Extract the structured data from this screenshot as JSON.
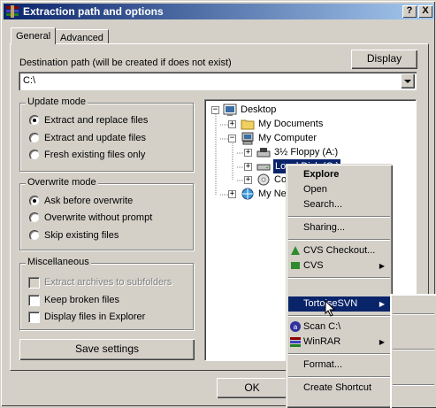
{
  "window": {
    "title": "Extraction path and options",
    "help_button": "?",
    "close_button": "X"
  },
  "tabs": [
    {
      "label": "General"
    },
    {
      "label": "Advanced"
    }
  ],
  "destination": {
    "label": "Destination path (will be created if does not exist)",
    "value": "C:\\",
    "display_button": "Display"
  },
  "update_mode": {
    "title": "Update mode",
    "options": [
      {
        "label": "Extract and replace files",
        "selected": true
      },
      {
        "label": "Extract and update files",
        "selected": false
      },
      {
        "label": "Fresh existing files only",
        "selected": false
      }
    ]
  },
  "overwrite_mode": {
    "title": "Overwrite mode",
    "options": [
      {
        "label": "Ask before overwrite",
        "selected": true
      },
      {
        "label": "Overwrite without prompt",
        "selected": false
      },
      {
        "label": "Skip existing files",
        "selected": false
      }
    ]
  },
  "misc": {
    "title": "Miscellaneous",
    "options": [
      {
        "label": "Extract archives to subfolders",
        "checked": false,
        "disabled": true
      },
      {
        "label": "Keep broken files",
        "checked": false,
        "disabled": false
      },
      {
        "label": "Display files in Explorer",
        "checked": false,
        "disabled": false
      }
    ]
  },
  "save_button": "Save settings",
  "ok_button": "OK",
  "tree": {
    "nodes": [
      {
        "label": "Desktop",
        "icon": "desktop-icon",
        "expander": "−"
      },
      {
        "label": "My Documents",
        "icon": "folder-icon",
        "expander": "+"
      },
      {
        "label": "My Computer",
        "icon": "computer-icon",
        "expander": "−"
      },
      {
        "label": "3½ Floppy (A:)",
        "icon": "floppy-icon",
        "expander": "+"
      },
      {
        "label": "Local Disk (C:)",
        "icon": "harddisk-icon",
        "expander": "+"
      },
      {
        "label": "Co",
        "icon": "cdrom-icon",
        "expander": "+"
      },
      {
        "label": "My Ne",
        "icon": "network-icon",
        "expander": "+"
      }
    ]
  },
  "context_menu": {
    "items": [
      {
        "label": "Explore",
        "bold": true
      },
      {
        "label": "Open"
      },
      {
        "label": "Search..."
      },
      {
        "label": "Sharing..."
      },
      {
        "label": "CVS Checkout...",
        "icon": "cvs-checkout-icon"
      },
      {
        "label": "CVS",
        "icon": "cvs-icon",
        "submenu": true
      },
      {
        "label": "TortoiseSVN",
        "submenu": true,
        "highlighted": true
      },
      {
        "label": "Scan C:\\",
        "icon": "scan-icon"
      },
      {
        "label": "WinRAR",
        "icon": "winrar-icon",
        "submenu": true
      },
      {
        "label": "Format..."
      },
      {
        "label": "Create Shortcut"
      }
    ]
  },
  "colors": {
    "title_gradient_start": "#0a246a",
    "title_gradient_end": "#a6caf0",
    "face": "#d4d0c8",
    "highlight": "#0a246a"
  }
}
